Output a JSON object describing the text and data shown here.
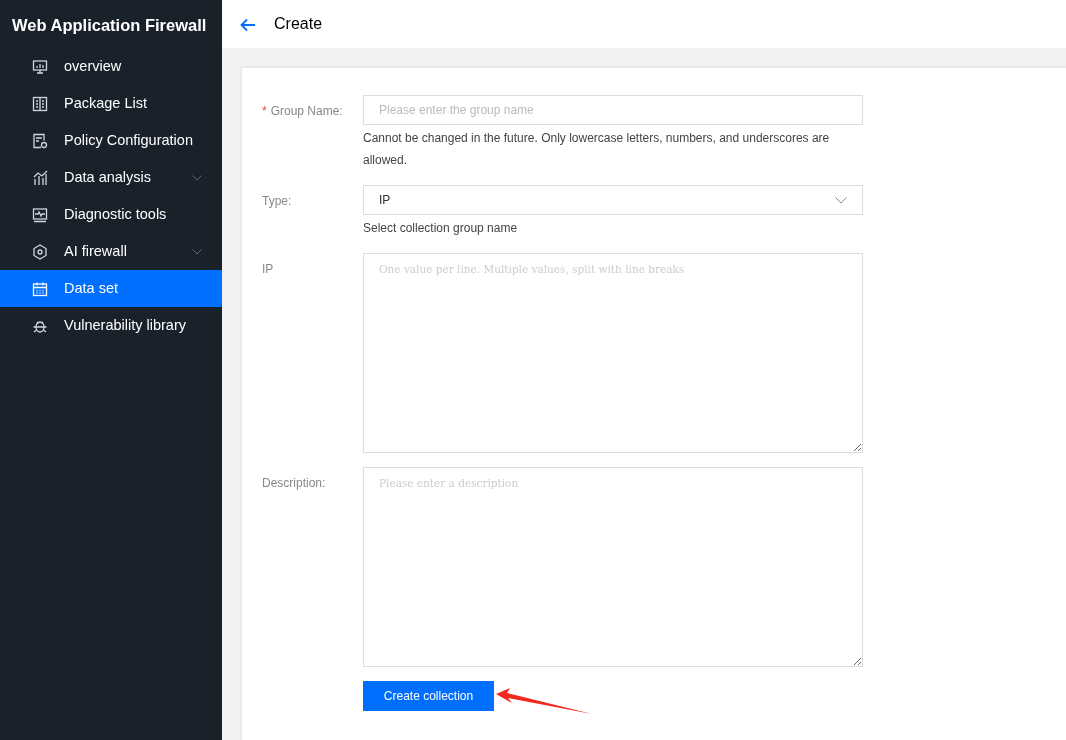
{
  "sidebar": {
    "title": "Web Application Firewall",
    "items": [
      {
        "label": "overview",
        "expandable": false,
        "selected": false
      },
      {
        "label": "Package List",
        "expandable": false,
        "selected": false
      },
      {
        "label": "Policy Configuration",
        "expandable": false,
        "selected": false
      },
      {
        "label": "Data analysis",
        "expandable": true,
        "selected": false
      },
      {
        "label": "Diagnostic tools",
        "expandable": false,
        "selected": false
      },
      {
        "label": "AI firewall",
        "expandable": true,
        "selected": false
      },
      {
        "label": "Data set",
        "expandable": false,
        "selected": true
      },
      {
        "label": "Vulnerability library",
        "expandable": false,
        "selected": false
      }
    ]
  },
  "header": {
    "title": "Create"
  },
  "form": {
    "fields": [
      {
        "kind": "input",
        "label": "Group Name:",
        "required": true,
        "required_mark": "*",
        "placeholder": "Please enter the group name",
        "help": "Cannot be changed in the future. Only lowercase letters, numbers, and underscores are allowed."
      },
      {
        "kind": "select",
        "label": "Type:",
        "required": false,
        "value": "IP",
        "help": "Select collection group name"
      },
      {
        "kind": "textarea",
        "label": "IP",
        "required": false,
        "placeholder": "One value per line. Multiple values, split with line breaks"
      },
      {
        "kind": "textarea",
        "label": "Description:",
        "required": false,
        "placeholder": "Please enter a description"
      }
    ],
    "submit": "Create collection"
  }
}
